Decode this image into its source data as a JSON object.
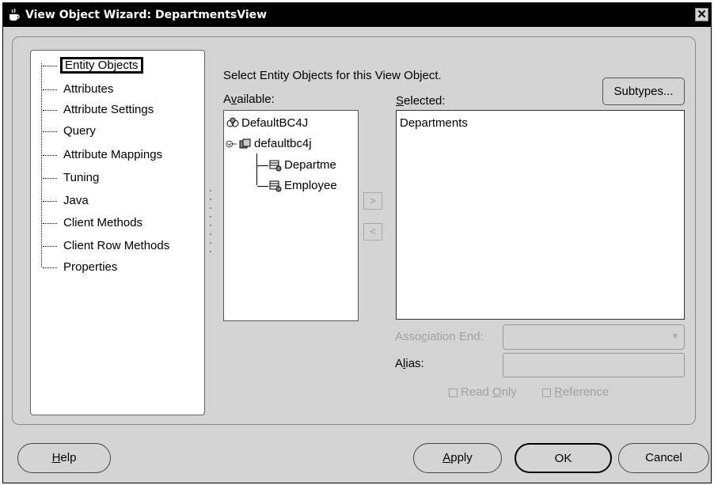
{
  "window": {
    "title": "View Object Wizard: DepartmentsView",
    "close_glyph": "✕"
  },
  "nav": {
    "items": [
      {
        "label": "Entity Objects",
        "selected": true
      },
      {
        "label": "Attributes"
      },
      {
        "label": "Attribute Settings"
      },
      {
        "label": "Query"
      },
      {
        "label": "Attribute Mappings"
      },
      {
        "label": "Tuning"
      },
      {
        "label": "Java"
      },
      {
        "label": "Client Methods"
      },
      {
        "label": "Client Row Methods"
      },
      {
        "label": "Properties"
      }
    ]
  },
  "main": {
    "instruction": "Select Entity Objects for this View Object.",
    "subtypes_label": "Subtypes...",
    "available_label": "Available:",
    "selected_label": "Selected:",
    "available_tree": {
      "root": "DefaultBC4J",
      "package": "defaultbc4j",
      "entities": [
        "Departme",
        "Employee"
      ]
    },
    "selected_items": [
      "Departments"
    ],
    "association_end_label": "Association End:",
    "alias_label": "Alias:",
    "read_only_label": "Read Only",
    "reference_label": "Reference"
  },
  "buttons": {
    "help": "Help",
    "apply": "Apply",
    "ok": "OK",
    "cancel": "Cancel"
  }
}
